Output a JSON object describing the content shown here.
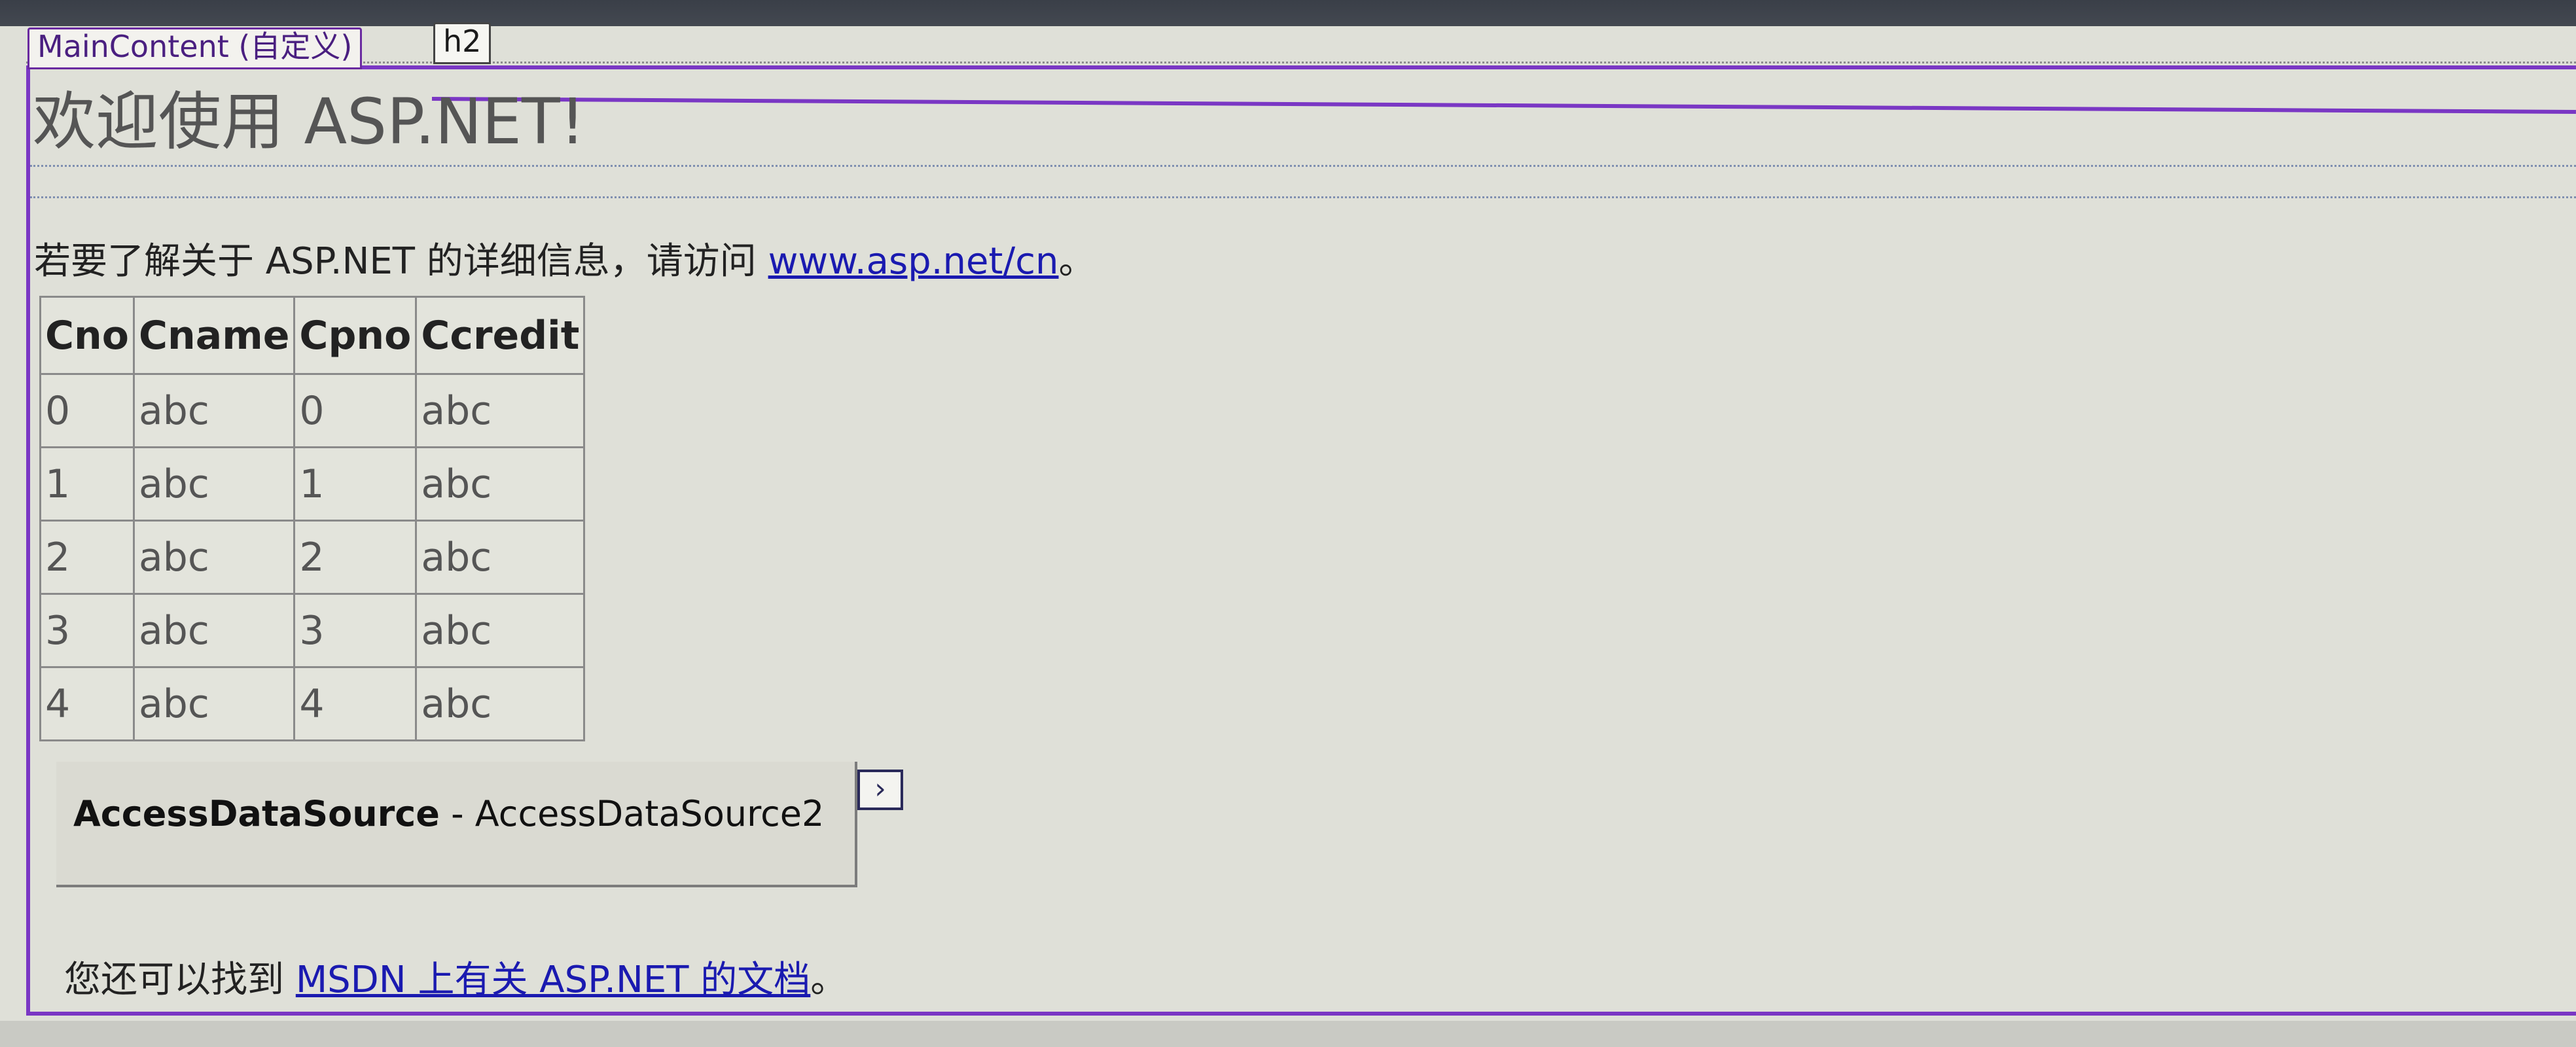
{
  "designer": {
    "content_tag": "MainContent (自定义)",
    "heading_tag": "h2"
  },
  "page": {
    "heading": "欢迎使用 ASP.NET!",
    "intro_prefix": "若要了解关于 ASP.NET 的详细信息，请访问 ",
    "intro_link": "www.asp.net/cn",
    "intro_suffix": "。",
    "footer_prefix": "您还可以找到 ",
    "footer_link": "MSDN 上有关 ASP.NET 的文档",
    "footer_suffix": "。"
  },
  "grid": {
    "columns": [
      "Cno",
      "Cname",
      "Cpno",
      "Ccredit"
    ],
    "rows": [
      [
        "0",
        "abc",
        "0",
        "abc"
      ],
      [
        "1",
        "abc",
        "1",
        "abc"
      ],
      [
        "2",
        "abc",
        "2",
        "abc"
      ],
      [
        "3",
        "abc",
        "3",
        "abc"
      ],
      [
        "4",
        "abc",
        "4",
        "abc"
      ]
    ]
  },
  "datasource": {
    "type_label": "AccessDataSource",
    "separator": " - ",
    "id_label": "AccessDataSource2",
    "smart_tag_glyph": "›"
  },
  "colors": {
    "region_border": "#7a37c4",
    "link": "#1a1ab0"
  }
}
